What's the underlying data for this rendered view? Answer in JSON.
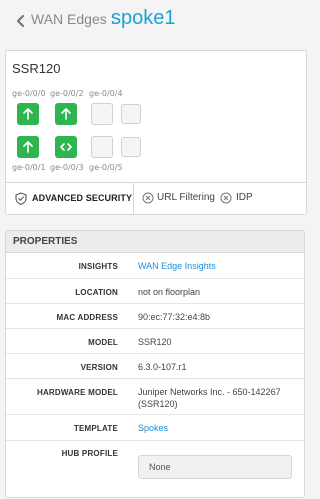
{
  "breadcrumb": {
    "parent": "WAN Edges :",
    "current": "spoke1"
  },
  "device": {
    "model": "SSR120",
    "ports_top": [
      {
        "label": "ge-0/0/0",
        "state": "up"
      },
      {
        "label": "ge-0/0/2",
        "state": "up"
      },
      {
        "label": "ge-0/0/4",
        "state": "down"
      }
    ],
    "ports_bottom": [
      {
        "label": "ge-0/0/1",
        "state": "up"
      },
      {
        "label": "ge-0/0/3",
        "state": "bidirectional"
      },
      {
        "label": "ge-0/0/5",
        "state": "down"
      }
    ],
    "port_colors": {
      "up": "#2fb54f",
      "down": "#f5f5f5"
    }
  },
  "security_tabs": {
    "advanced": "ADVANCED SECURITY",
    "url": "URL Filtering",
    "idp": "IDP"
  },
  "properties": {
    "title": "PROPERTIES",
    "insights": {
      "key": "INSIGHTS",
      "value": "WAN Edge Insights"
    },
    "location": {
      "key": "LOCATION",
      "value": "not on floorplan"
    },
    "mac": {
      "key": "MAC ADDRESS",
      "value": "90:ec:77:32:e4:8b"
    },
    "model": {
      "key": "MODEL",
      "value": "SSR120"
    },
    "version": {
      "key": "VERSION",
      "value": "6.3.0-107.r1"
    },
    "hardware": {
      "key": "HARDWARE MODEL",
      "value_line1": "Juniper Networks Inc. - 650-142267",
      "value_line2": "(SSR120)"
    },
    "template": {
      "key": "TEMPLATE",
      "value": "Spokes"
    },
    "hub_profile": {
      "key": "HUB PROFILE",
      "value": "None"
    }
  },
  "colors": {
    "link": "#1a8fd6",
    "accent": "#1aa3d6",
    "port_green": "#2fb54f"
  }
}
